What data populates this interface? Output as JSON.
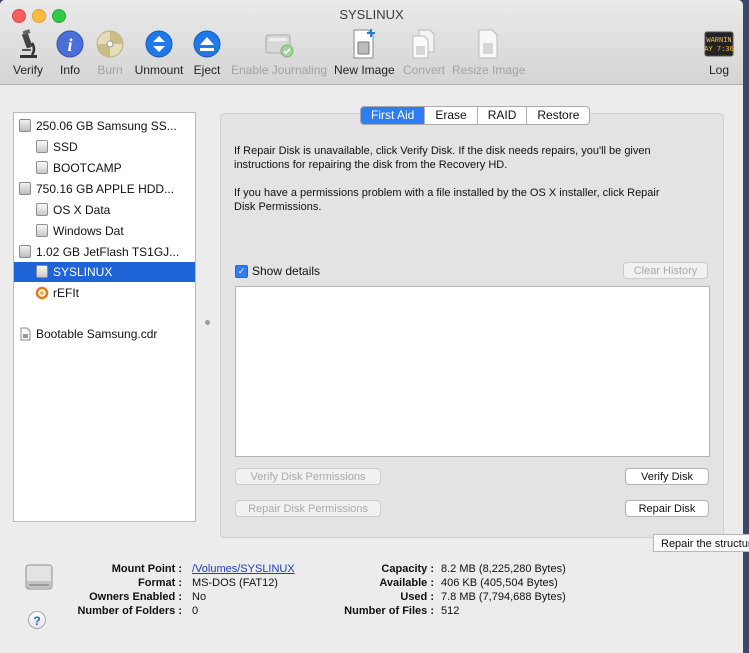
{
  "window": {
    "title": "SYSLINUX"
  },
  "toolbar": {
    "verify": "Verify",
    "info": "Info",
    "burn": "Burn",
    "unmount": "Unmount",
    "eject": "Eject",
    "enable_journaling": "Enable Journaling",
    "new_image": "New Image",
    "convert": "Convert",
    "resize_image": "Resize Image",
    "log": "Log",
    "log_icon_text_1": "WARNIN",
    "log_icon_text_2": "AY 7:36"
  },
  "sidebar": {
    "items": [
      {
        "label": "250.06 GB Samsung SS..."
      },
      {
        "label": "SSD"
      },
      {
        "label": "BOOTCAMP"
      },
      {
        "label": "750.16 GB APPLE HDD..."
      },
      {
        "label": "OS X Data"
      },
      {
        "label": "Windows Dat"
      },
      {
        "label": "1.02 GB JetFlash TS1GJ..."
      },
      {
        "label": "SYSLINUX"
      },
      {
        "label": "rEFIt"
      },
      {
        "label": "Bootable Samsung.cdr"
      }
    ]
  },
  "tabs": {
    "first_aid": "First Aid",
    "erase": "Erase",
    "raid": "RAID",
    "restore": "Restore"
  },
  "first_aid": {
    "info1_line1": "If Repair Disk is unavailable, click Verify Disk. If the disk needs repairs, you'll be given",
    "info1_line2": "instructions for repairing the disk from the Recovery HD.",
    "info2_line1": "If you have a permissions problem with a file installed by the OS X installer, click Repair",
    "info2_line2": "Disk Permissions.",
    "show_details": "Show details",
    "checkmark": "✓",
    "clear_history": "Clear History",
    "verify_permissions": "Verify Disk Permissions",
    "repair_permissions": "Repair Disk Permissions",
    "verify_disk": "Verify Disk",
    "repair_disk": "Repair Disk"
  },
  "tooltip": "Repair the structure",
  "details": {
    "mount_point_label": "Mount Point :",
    "mount_point_value": "/Volumes/SYSLINUX",
    "format_label": "Format :",
    "format_value": "MS-DOS (FAT12)",
    "owners_label": "Owners Enabled :",
    "owners_value": "No",
    "folders_label": "Number of Folders :",
    "folders_value": "0",
    "capacity_label": "Capacity :",
    "capacity_value": "8.2 MB (8,225,280 Bytes)",
    "available_label": "Available :",
    "available_value": "406 KB (405,504 Bytes)",
    "used_label": "Used :",
    "used_value": "7.8 MB (7,794,688 Bytes)",
    "files_label": "Number of Files :",
    "files_value": "512",
    "help": "?"
  }
}
